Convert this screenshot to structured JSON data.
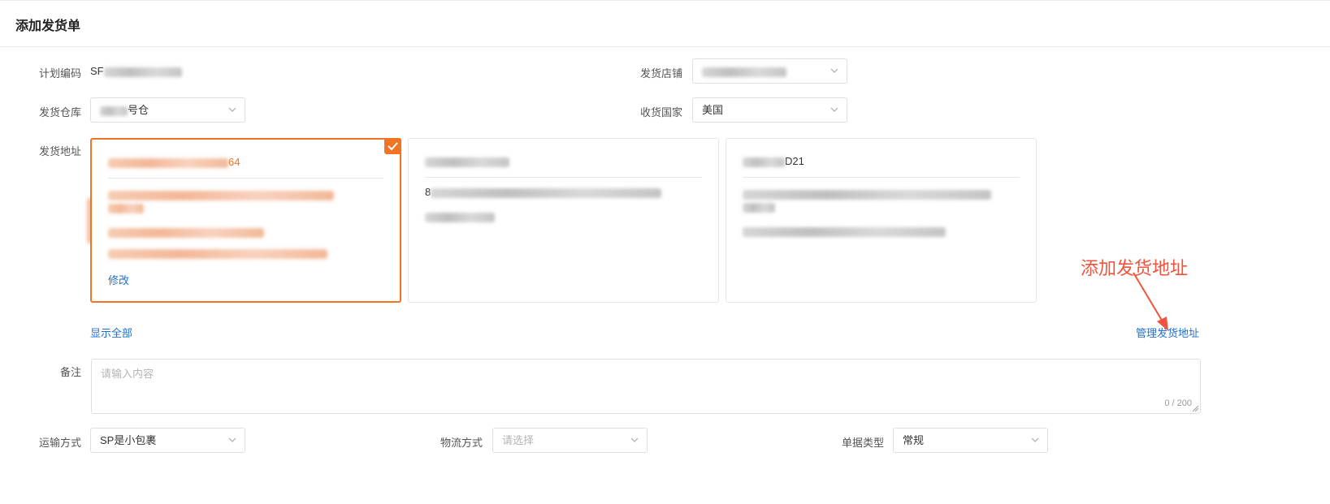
{
  "page": {
    "title": "添加发货单"
  },
  "form": {
    "plan_code": {
      "label": "计划编码",
      "value_prefix": "SF"
    },
    "ship_store": {
      "label": "发货店铺"
    },
    "ship_warehouse": {
      "label": "发货仓库",
      "value_suffix": "号仓"
    },
    "receive_country": {
      "label": "收货国家",
      "value": "美国"
    },
    "ship_address": {
      "label": "发货地址"
    },
    "remark": {
      "label": "备注",
      "placeholder": "请输入内容",
      "counter": "0 / 200"
    },
    "transport": {
      "label": "运输方式",
      "value": "SP是小包裹"
    },
    "logistics": {
      "label": "物流方式",
      "placeholder": "请选择"
    },
    "doc_type": {
      "label": "单据类型",
      "value": "常规"
    }
  },
  "address_cards": [
    {
      "selected": true,
      "title_suffix": "64",
      "edit_label": "修改"
    },
    {
      "selected": false,
      "line1_prefix": "8"
    },
    {
      "selected": false,
      "title_suffix": "D21"
    }
  ],
  "links": {
    "show_all": "显示全部",
    "manage_address": "管理发货地址"
  },
  "annotation": {
    "text": "添加发货地址"
  },
  "colors": {
    "accent": "#f07424",
    "link": "#1f6fd0",
    "annotation": "#f0543c"
  },
  "icons": {
    "chevron": "chevron-down-icon",
    "check": "check-icon",
    "arrow": "arrow-icon"
  }
}
